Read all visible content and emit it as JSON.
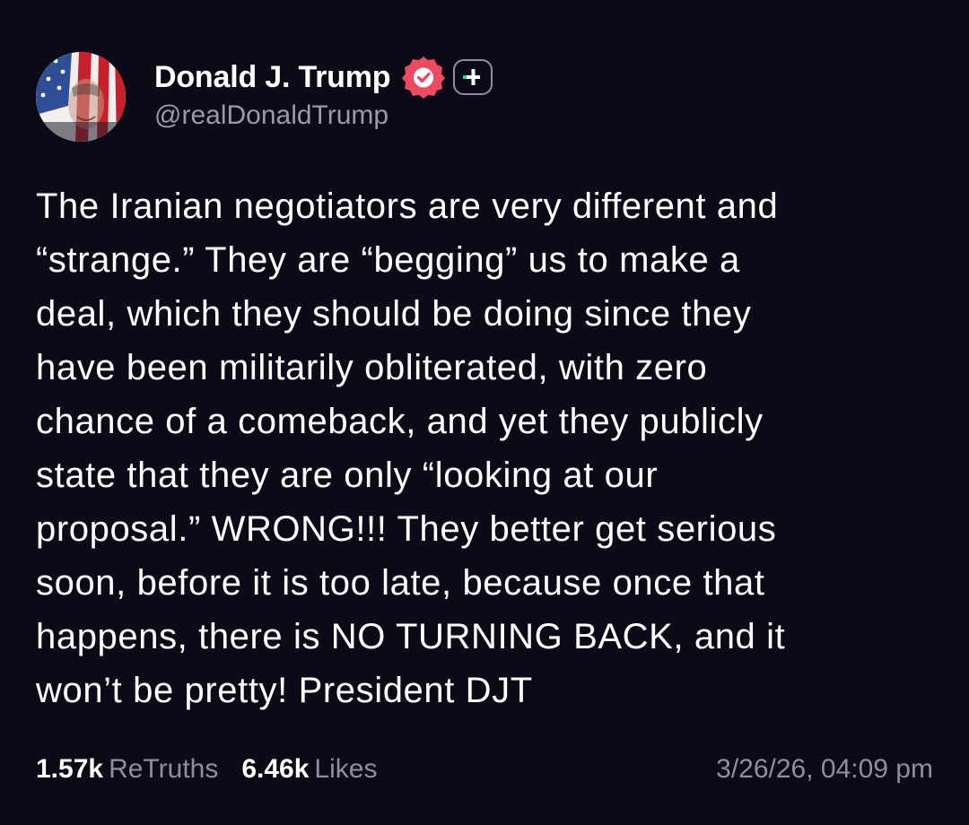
{
  "author": {
    "display_name": "Donald J. Trump",
    "handle": "@realDonaldTrump",
    "verified_icon": "verified-check-icon",
    "plus_icon": "plus-icon",
    "avatar_icon": "profile-avatar"
  },
  "post": {
    "text": "The Iranian negotiators are very different and\n“strange.” They are “begging” us to make a\ndeal, which they should be doing since they\nhave been militarily obliterated, with zero\nchance of a comeback, and yet they publicly\nstate that they are only “looking at our\nproposal.” WRONG!!! They better get serious\nsoon, before it is too late, because once that\nhappens, there is NO TURNING BACK, and it\nwon’t be pretty! President DJT"
  },
  "stats": {
    "retruths_count": "1.57k",
    "retruths_label": "ReTruths",
    "likes_count": "6.46k",
    "likes_label": "Likes",
    "timestamp": "3/26/26, 04:09 pm"
  },
  "colors": {
    "background": "#0b0a17",
    "verified_badge": "#ec4a63",
    "muted_text": "#8e8da3",
    "plus_accent": "#22d3b4"
  }
}
